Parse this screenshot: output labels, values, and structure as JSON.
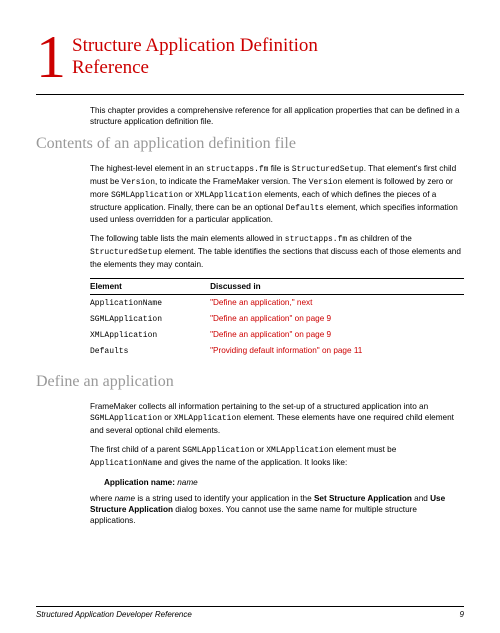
{
  "chapter": {
    "number": "1",
    "title_l1": "Structure Application Definition",
    "title_l2": "Reference"
  },
  "intro": {
    "p1a": "This chapter provides a comprehensive reference for all application properties that can be defined in a structure application definition file."
  },
  "section1": {
    "heading": "Contents of an application definition file",
    "p1_a": "The highest-level element in an ",
    "p1_code1": "structapps.fm",
    "p1_b": " file is ",
    "p1_code2": "StructuredSetup",
    "p1_c": ". That element's first child must be ",
    "p1_code3": "Version",
    "p1_d": ", to indicate the FrameMaker version. The ",
    "p1_code4": "Version",
    "p1_e": " element is followed by zero or more ",
    "p1_code5": "SGMLApplication",
    "p1_f": " or ",
    "p1_code6": "XMLApplication",
    "p1_g": " elements, each of which defines the pieces of a structure application. Finally, there can be an optional ",
    "p1_code7": "Defaults",
    "p1_h": " element, which specifies information used unless overridden for a particular application.",
    "p2_a": "The following table lists the main elements allowed in ",
    "p2_code1": "structapps.fm",
    "p2_b": " as children of the ",
    "p2_code2": "StructuredSetup",
    "p2_c": " element. The table identifies the sections that discuss each of those elements and the elements they may contain.",
    "table": {
      "h1": "Element",
      "h2": "Discussed in",
      "rows": [
        {
          "el": "ApplicationName",
          "link": "\"Define an application,\" next"
        },
        {
          "el": "SGMLApplication",
          "link": "\"Define an application\" on page 9"
        },
        {
          "el": "XMLApplication",
          "link": "\"Define an application\" on page 9"
        },
        {
          "el": "Defaults",
          "link": "\"Providing default information\" on page 11"
        }
      ]
    }
  },
  "section2": {
    "heading": "Define an application",
    "p1_a": "FrameMaker collects all information pertaining to the set-up of a structured application into an ",
    "p1_code1": "SGMLApplication",
    "p1_b": " or ",
    "p1_code2": "XMLApplication",
    "p1_c": " element. These elements have one required child element and several optional child elements.",
    "p2_a": "The first child of a parent ",
    "p2_code1": "SGMLApplication",
    "p2_b": " or ",
    "p2_code2": "XMLApplication",
    "p2_c": " element must be ",
    "p2_code3": "ApplicationName",
    "p2_d": " and gives the name of the application. It looks like:",
    "param_label": "Application name:",
    "param_var": "name",
    "p3_a": "where ",
    "p3_var": "name",
    "p3_b": " is a string used to identify your application in the ",
    "p3_bold1": "Set Structure Application",
    "p3_c": " and ",
    "p3_bold2": "Use Structure Application",
    "p3_d": " dialog boxes. You cannot use the same name for multiple structure applications."
  },
  "footer": {
    "left": "Structured Application Developer Reference",
    "right": "9"
  }
}
